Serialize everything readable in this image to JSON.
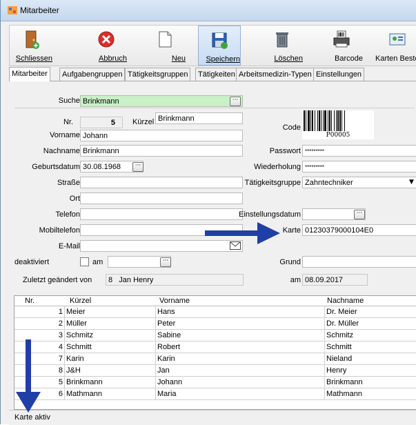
{
  "window": {
    "title": "Mitarbeiter"
  },
  "toolbar": {
    "buttons": [
      {
        "label": "Schliessen",
        "icon": "door-exit-icon"
      },
      {
        "label": "Abbruch",
        "icon": "cancel-icon"
      },
      {
        "label": "Neu",
        "icon": "new-document-icon"
      },
      {
        "label": "Speichern",
        "icon": "save-icon"
      },
      {
        "label": "Löschen",
        "icon": "trash-icon"
      },
      {
        "label": "Barcode",
        "icon": "barcode-printer-icon"
      },
      {
        "label": "Karten Bestel",
        "icon": "card-order-icon"
      }
    ]
  },
  "tabs": [
    "Mitarbeiter",
    "Aufgabengruppen",
    "Tätigkeitsgruppen",
    "Tätigkeiten",
    "Arbeitsmedizin-Typen",
    "Einstellungen"
  ],
  "form": {
    "suche_label": "Suche",
    "suche_value": "Brinkmann",
    "nr_label": "Nr.",
    "nr_value": "5",
    "kuerzel_label": "Kürzel",
    "kuerzel_value": "Brinkmann",
    "code_label": "Code",
    "barcode_text": "P00005",
    "vorname_label": "Vorname",
    "vorname_value": "Johann",
    "nachname_label": "Nachname",
    "nachname_value": "Brinkmann",
    "passwort_label": "Passwort",
    "passwort_value": "*********",
    "geburtsdatum_label": "Geburtsdatum",
    "geburtsdatum_value": "30.08.1968",
    "wiederholung_label": "Wiederholung",
    "wiederholung_value": "*********",
    "strasse_label": "Straße",
    "strasse_value": "",
    "taetigkeitsgruppe_label": "Tätigkeitsgruppe",
    "taetigkeitsgruppe_value": "Zahntechniker",
    "ort_label": "Ort",
    "ort_value": "",
    "telefon_label": "Telefon",
    "telefon_value": "",
    "einstellungsdatum_label": "Einstellungsdatum",
    "einstellungsdatum_value": "",
    "mobiltelefon_label": "Mobiltelefon",
    "mobiltelefon_value": "",
    "karte_label": "Karte",
    "karte_value": "01230379000104E0",
    "email_label": "E-Mail",
    "email_value": "",
    "deaktiviert_label": "deaktiviert",
    "am_label": "am",
    "am_value": "",
    "grund_label": "Grund",
    "grund_value": "",
    "zuletzt_label": "Zuletzt geändert von",
    "zuletzt_nr": "8",
    "zuletzt_name": "Jan Henry",
    "am2_label": "am",
    "am2_value": "08.09.2017"
  },
  "grid": {
    "columns": [
      "Nr.",
      "Kürzel",
      "Vorname",
      "Nachname"
    ],
    "rows": [
      [
        "1",
        "Meier",
        "Hans",
        "Dr. Meier"
      ],
      [
        "2",
        "Müller",
        "Peter",
        "Dr. Müller"
      ],
      [
        "3",
        "Schmitz",
        "Sabine",
        "Schmitz"
      ],
      [
        "4",
        "Schmitt",
        "Robert",
        "Schmitt"
      ],
      [
        "7",
        "Karin",
        "Karin",
        "Nieland"
      ],
      [
        "8",
        "J&H",
        "Jan",
        "Henry"
      ],
      [
        "5",
        "Brinkmann",
        "Johann",
        "Brinkmann"
      ],
      [
        "6",
        "Mathmann",
        "Maria",
        "Mathmann"
      ]
    ]
  },
  "status": {
    "text": "Karte aktiv"
  },
  "colors": {
    "arrow": "#1f3fa6",
    "search_bg": "#c9f0c6",
    "accent": "#c7dcf3"
  }
}
